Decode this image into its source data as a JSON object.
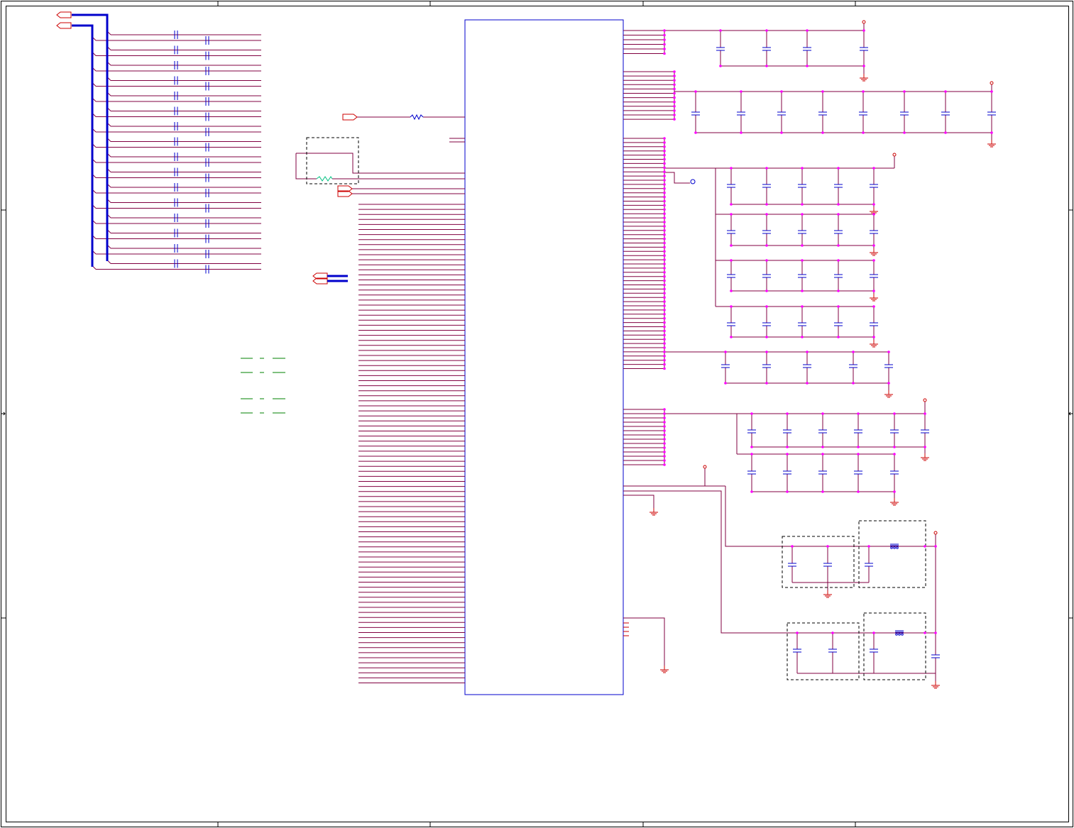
{
  "sheet": {
    "text_labels": [],
    "grid_zone_count_horizontal": 5,
    "grid_zone_count_vertical": 4
  },
  "colors": {
    "background": "#ffffff",
    "frame": "#000000",
    "wire": "#800040",
    "net_label": "#cc0000",
    "part_outline": "#0000cc",
    "bus": "#0000cc",
    "junction": "#ff00ff",
    "component_body": "#0000cc",
    "power_symbol": "#cc0000",
    "green_annotation": "#008000",
    "teal_inductor": "#00c080",
    "dashed_box": "#000000"
  },
  "symbols": {
    "main_ic": "ic-body",
    "capacitor": "capacitor-symbol",
    "resistor": "resistor-symbol",
    "ground": "ground-symbol",
    "power_port": "power-port-symbol",
    "ferrite": "ferrite-bead-symbol",
    "off_page_connector": "off-page-connector-symbol"
  }
}
